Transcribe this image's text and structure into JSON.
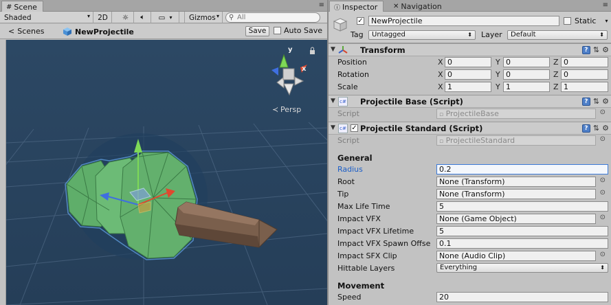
{
  "scene": {
    "tab_label": "Scene",
    "toolbar": {
      "shading": "Shaded",
      "mode_2d": "2D",
      "gizmos": "Gizmos",
      "search_placeholder": "All"
    },
    "breadcrumb": {
      "root": "Scenes",
      "object": "NewProjectile"
    },
    "save_label": "Save",
    "autosave_label": "Auto Save",
    "gizmo_axes": {
      "y": "y",
      "x": "x"
    },
    "projection_label": "Persp"
  },
  "inspector": {
    "tabs": [
      {
        "label": "Inspector"
      },
      {
        "label": "Navigation"
      }
    ],
    "object_name": "NewProjectile",
    "static_label": "Static",
    "tag_label": "Tag",
    "tag_value": "Untagged",
    "layer_label": "Layer",
    "layer_value": "Default",
    "transform": {
      "title": "Transform",
      "position_label": "Position",
      "rotation_label": "Rotation",
      "scale_label": "Scale",
      "axis_x": "X",
      "axis_y": "Y",
      "axis_z": "Z",
      "position": {
        "x": "0",
        "y": "0",
        "z": "0"
      },
      "rotation": {
        "x": "0",
        "y": "0",
        "z": "0"
      },
      "scale": {
        "x": "1",
        "y": "1",
        "z": "1"
      }
    },
    "projectile_base": {
      "title": "Projectile Base (Script)",
      "script_label": "Script",
      "script_value": "ProjectileBase"
    },
    "projectile_standard": {
      "title": "Projectile Standard (Script)",
      "script_label": "Script",
      "script_value": "ProjectileStandard",
      "general_header": "General",
      "fields": [
        {
          "label": "Radius",
          "value": "0.2"
        },
        {
          "label": "Root",
          "value": "None (Transform)"
        },
        {
          "label": "Tip",
          "value": "None (Transform)"
        },
        {
          "label": "Max Life Time",
          "value": "5"
        },
        {
          "label": "Impact VFX",
          "value": "None (Game Object)"
        },
        {
          "label": "Impact VFX Lifetime",
          "value": "5"
        },
        {
          "label": "Impact VFX Spawn Offse",
          "value": "0.1"
        },
        {
          "label": "Impact SFX Clip",
          "value": "None (Audio Clip)"
        },
        {
          "label": "Hittable Layers",
          "value": "Everything"
        }
      ],
      "movement_header": "Movement",
      "speed_label": "Speed",
      "speed_value": "20"
    }
  },
  "colors": {
    "viewport_bg": "#2f4a66",
    "projectile_green": "#5fae6a",
    "projectile_brown": "#7a5f4c",
    "selection_blue": "#3b7ad8"
  }
}
